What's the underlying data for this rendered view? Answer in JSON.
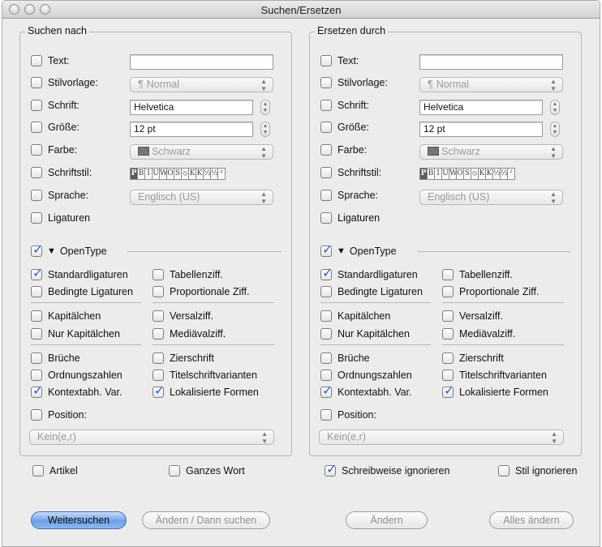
{
  "window": {
    "title": "Suchen/Ersetzen"
  },
  "find": {
    "legend": "Suchen nach",
    "text": {
      "label": "Text:",
      "checked": false,
      "value": ""
    },
    "stilvorlage": {
      "label": "Stilvorlage:",
      "checked": false,
      "value": "Normal",
      "icon": "pilcrow-icon"
    },
    "schrift": {
      "label": "Schrift:",
      "checked": false,
      "value": "Helvetica"
    },
    "groesse": {
      "label": "Größe:",
      "checked": false,
      "value": "12 pt"
    },
    "farbe": {
      "label": "Farbe:",
      "checked": false,
      "value": "Schwarz"
    },
    "schriftstil": {
      "label": "Schriftstil:",
      "checked": false,
      "buttons": [
        "P",
        "B",
        "I",
        "U",
        "W",
        "O",
        "S",
        "⦸",
        "K",
        "K",
        "½",
        "½",
        "²"
      ]
    },
    "sprache": {
      "label": "Sprache:",
      "checked": false,
      "value": "Englisch (US)"
    },
    "ligaturen": {
      "label": "Ligaturen",
      "checked": false
    },
    "opentype": {
      "label": "OpenType",
      "checked": true,
      "expanded": true
    },
    "ot": [
      [
        {
          "label": "Standardligaturen",
          "checked": true
        },
        {
          "label": "Tabellenziff.",
          "checked": false
        }
      ],
      [
        {
          "label": "Bedingte Ligaturen",
          "checked": false
        },
        {
          "label": "Proportionale Ziff.",
          "checked": false
        }
      ],
      [
        {
          "label": "Kapitälchen",
          "checked": false
        },
        {
          "label": "Versalziff.",
          "checked": false
        }
      ],
      [
        {
          "label": "Nur Kapitälchen",
          "checked": false
        },
        {
          "label": "Mediävalziff.",
          "checked": false
        }
      ],
      [
        {
          "label": "Brüche",
          "checked": false
        },
        {
          "label": "Zierschrift",
          "checked": false
        }
      ],
      [
        {
          "label": "Ordnungszahlen",
          "checked": false
        },
        {
          "label": "Titelschriftvarianten",
          "checked": false
        }
      ],
      [
        {
          "label": "Kontextabh. Var.",
          "checked": true
        },
        {
          "label": "Lokalisierte Formen",
          "checked": true
        }
      ]
    ],
    "position": {
      "label": "Position:",
      "checked": false,
      "value": "Kein(e,r)"
    }
  },
  "replace": {
    "legend": "Ersetzen durch",
    "text": {
      "label": "Text:",
      "checked": false,
      "value": ""
    },
    "stilvorlage": {
      "label": "Stilvorlage:",
      "checked": false,
      "value": "Normal",
      "icon": "pilcrow-icon"
    },
    "schrift": {
      "label": "Schrift:",
      "checked": false,
      "value": "Helvetica"
    },
    "groesse": {
      "label": "Größe:",
      "checked": false,
      "value": "12 pt"
    },
    "farbe": {
      "label": "Farbe:",
      "checked": false,
      "value": "Schwarz"
    },
    "schriftstil": {
      "label": "Schriftstil:",
      "checked": false,
      "buttons": [
        "P",
        "B",
        "I",
        "U",
        "W",
        "O",
        "S",
        "⦸",
        "K",
        "K",
        "½",
        "½",
        "²"
      ]
    },
    "sprache": {
      "label": "Sprache:",
      "checked": false,
      "value": "Englisch (US)"
    },
    "ligaturen": {
      "label": "Ligaturen",
      "checked": false
    },
    "opentype": {
      "label": "OpenType",
      "checked": true,
      "expanded": true
    },
    "ot": [
      [
        {
          "label": "Standardligaturen",
          "checked": true
        },
        {
          "label": "Tabellenziff.",
          "checked": false
        }
      ],
      [
        {
          "label": "Bedingte Ligaturen",
          "checked": false
        },
        {
          "label": "Proportionale Ziff.",
          "checked": false
        }
      ],
      [
        {
          "label": "Kapitälchen",
          "checked": false
        },
        {
          "label": "Versalziff.",
          "checked": false
        }
      ],
      [
        {
          "label": "Nur Kapitälchen",
          "checked": false
        },
        {
          "label": "Mediävalziff.",
          "checked": false
        }
      ],
      [
        {
          "label": "Brüche",
          "checked": false
        },
        {
          "label": "Zierschrift",
          "checked": false
        }
      ],
      [
        {
          "label": "Ordnungszahlen",
          "checked": false
        },
        {
          "label": "Titelschriftvarianten",
          "checked": false
        }
      ],
      [
        {
          "label": "Kontextabh. Var.",
          "checked": true
        },
        {
          "label": "Lokalisierte Formen",
          "checked": true
        }
      ]
    ],
    "position": {
      "label": "Position:",
      "checked": false,
      "value": "Kein(e,r)"
    }
  },
  "options": {
    "artikel": {
      "label": "Artikel",
      "checked": false
    },
    "ganzes_wort": {
      "label": "Ganzes Wort",
      "checked": false
    },
    "schreibweise": {
      "label": "Schreibweise ignorieren",
      "checked": true
    },
    "stil_ignorieren": {
      "label": "Stil ignorieren",
      "checked": false
    }
  },
  "buttons": {
    "weitersuchen": "Weitersuchen",
    "aendern_dann_suchen": "Ändern / Dann suchen",
    "aendern": "Ändern",
    "alles_aendern": "Alles ändern"
  },
  "colors": {
    "accent": "#2f64c9",
    "default_button": "#6ea1e6"
  }
}
